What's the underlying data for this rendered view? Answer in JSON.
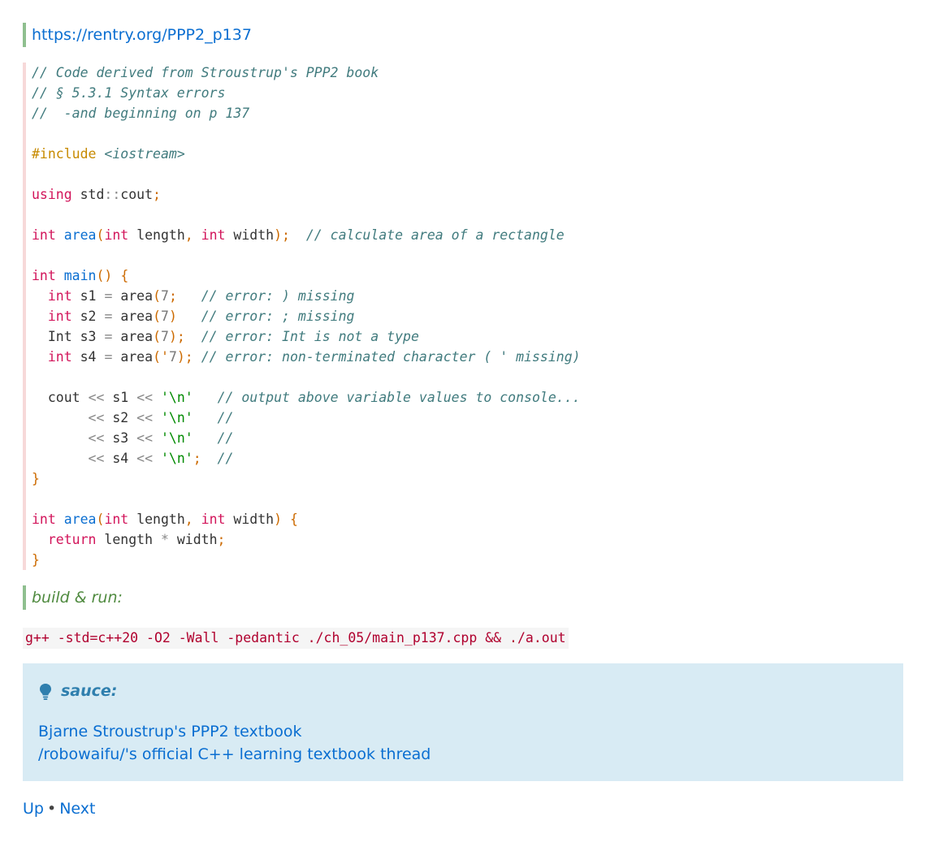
{
  "source_link": "https://rentry.org/PPP2_p137",
  "code": {
    "comment1": "// Code derived from Stroustrup's PPP2 book",
    "comment2": "// § 5.3.1 Syntax errors",
    "comment3": "//  -and beginning on p 137",
    "include_directive": "#include",
    "include_header": "<iostream>",
    "kw_using": "using",
    "using_target": "std",
    "using_sep": "::",
    "using_name": "cout",
    "kw_int": "int",
    "fn_area": "area",
    "fn_main": "main",
    "param_length": "length",
    "param_width": "width",
    "comment_area": "// calculate area of a rectangle",
    "var_s1": "s1",
    "var_s2": "s2",
    "var_s3": "s3",
    "var_s4": "s4",
    "type_Int": "Int",
    "num_7": "7",
    "err1": "// error: ) missing",
    "err2": "// error: ; missing",
    "err3": "// error: Int is not a type",
    "err4": "// error: non-terminated character ( ' missing)",
    "cout": "cout",
    "newline_lit": "'\\n'",
    "comment_output": "// output above variable values to console...",
    "comment_empty": "//",
    "kw_return": "return"
  },
  "build": {
    "label": "build & run:",
    "command": "g++ -std=c++20 -O2 -Wall -pedantic ./ch_05/main_p137.cpp && ./a.out"
  },
  "sauce": {
    "title": "sauce:",
    "icon": "lightbulb-icon",
    "links": [
      "Bjarne Stroustrup's PPP2 textbook",
      "/robowaifu/'s official C++ learning textbook thread"
    ]
  },
  "nav": {
    "up": "Up",
    "separator": "•",
    "next": "Next"
  }
}
